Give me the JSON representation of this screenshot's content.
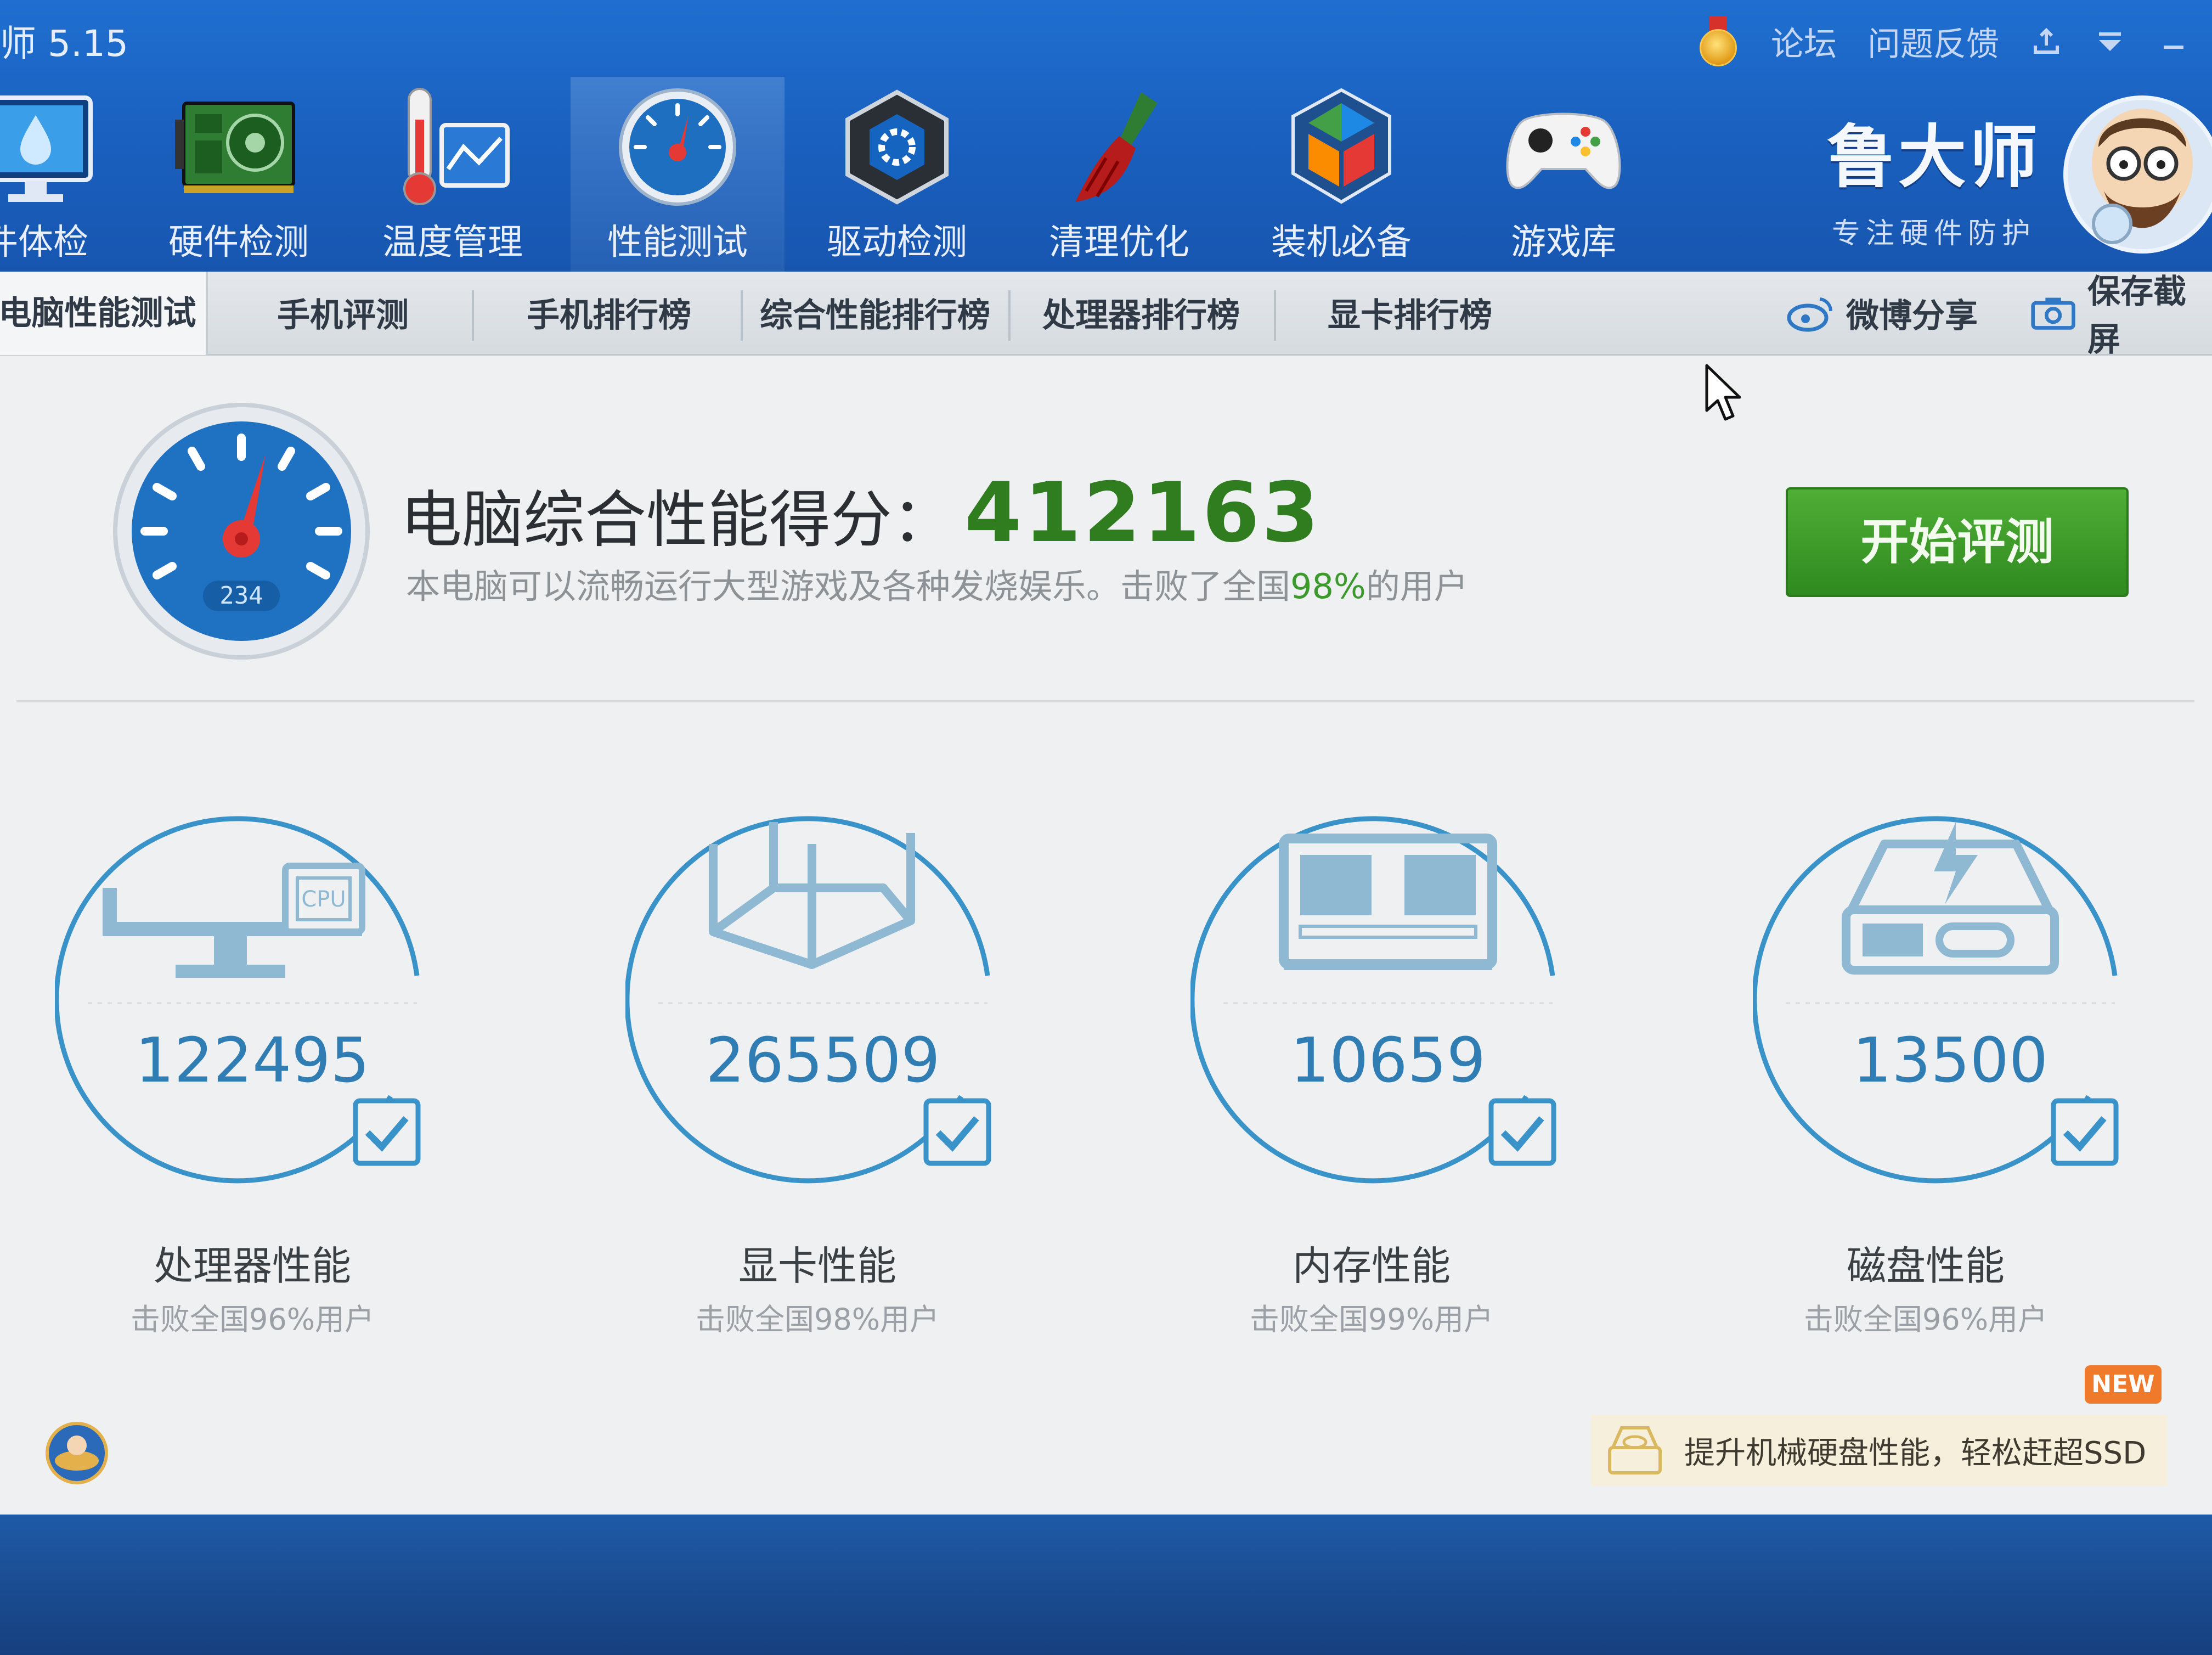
{
  "app": {
    "version_label": "师 5.15"
  },
  "top_links": {
    "forum": "论坛",
    "feedback": "问题反馈"
  },
  "nav": [
    {
      "label": "件体检",
      "icon": "monitor-drop-icon"
    },
    {
      "label": "硬件检测",
      "icon": "circuit-board-icon"
    },
    {
      "label": "温度管理",
      "icon": "thermometer-chart-icon"
    },
    {
      "label": "性能测试",
      "icon": "speedometer-icon",
      "active": true
    },
    {
      "label": "驱动检测",
      "icon": "driver-chip-icon"
    },
    {
      "label": "清理优化",
      "icon": "broom-icon"
    },
    {
      "label": "装机必备",
      "icon": "package-cube-icon"
    },
    {
      "label": "游戏库",
      "icon": "gamepad-icon"
    }
  ],
  "brand": {
    "name": "鲁大师",
    "slogan": "专注硬件防护"
  },
  "tabs": [
    {
      "label": "电脑性能测试",
      "active": true
    },
    {
      "label": "手机评测"
    },
    {
      "label": "手机排行榜"
    },
    {
      "label": "综合性能排行榜"
    },
    {
      "label": "处理器排行榜"
    },
    {
      "label": "显卡排行榜"
    }
  ],
  "tab_actions": {
    "weibo_share": "微博分享",
    "save_screenshot": "保存截屏"
  },
  "summary": {
    "title": "电脑综合性能得分：",
    "score": "412163",
    "desc_prefix": "本电脑可以流畅运行大型游戏及各种发烧娱乐。击败了全国",
    "desc_pct": "98%",
    "desc_suffix": "的用户",
    "gauge_readout": "234",
    "start_button": "开始评测"
  },
  "components": [
    {
      "title": "处理器性能",
      "score": "122495",
      "beat": "击败全国96%用户",
      "icon": "monitor-cpu-icon",
      "chip_text": "CPU"
    },
    {
      "title": "显卡性能",
      "score": "265509",
      "beat": "击败全国98%用户",
      "icon": "graphics-cube-icon"
    },
    {
      "title": "内存性能",
      "score": "10659",
      "beat": "击败全国99%用户",
      "icon": "memory-module-icon"
    },
    {
      "title": "磁盘性能",
      "score": "13500",
      "beat": "击败全国96%用户",
      "icon": "hard-disk-icon"
    }
  ],
  "promo": {
    "badge": "NEW",
    "text": "提升机械硬盘性能，轻松赶超SSD"
  },
  "colors": {
    "header_blue": "#1a5fbd",
    "score_green": "#2f7d1e",
    "ring_blue": "#3a93c8",
    "button_green": "#3f9d2b"
  }
}
